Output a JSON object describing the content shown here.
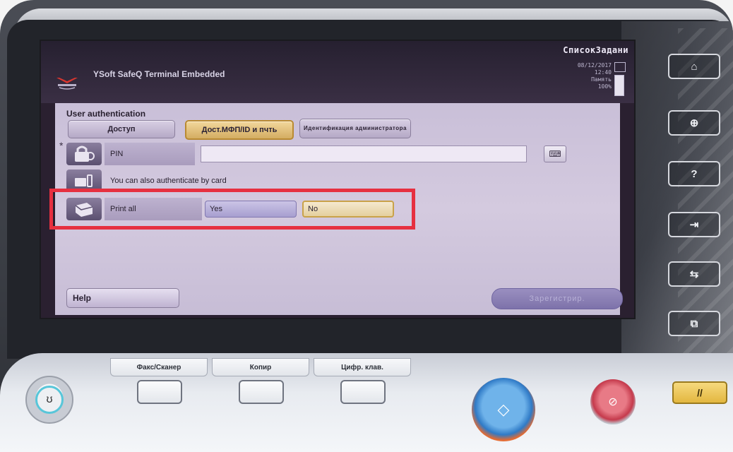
{
  "header": {
    "app_title": "YSoft SafeQ Terminal Embedded",
    "job_list": "СписокЗадани",
    "date": "08/12/2017",
    "time": "12:40",
    "memory_label": "Память",
    "memory_value": "100%"
  },
  "auth": {
    "section_title": "User authentication",
    "tabs": [
      {
        "label": "Доступ",
        "active": false
      },
      {
        "label": "Дост.МФП/ID и пчть",
        "active": true
      },
      {
        "label": "Идентификация администратора",
        "active": false
      }
    ],
    "required_marker": "*",
    "pin_label": "PIN",
    "pin_value": "",
    "card_hint": "You can also authenticate by card",
    "print_all_label": "Print all",
    "print_all_yes": "Yes",
    "print_all_no": "No",
    "print_all_selected": "No"
  },
  "footer": {
    "help_label": "Help",
    "register_label": "Зарегистрир."
  },
  "side_buttons": [
    {
      "icon": "home-icon"
    },
    {
      "icon": "zoom-in-icon"
    },
    {
      "icon": "help-icon"
    },
    {
      "icon": "job-icon"
    },
    {
      "icon": "utility-icon"
    },
    {
      "icon": "preview-icon"
    }
  ],
  "panel": {
    "tab_fax_scan": "Факс/Сканер",
    "tab_copy": "Копир",
    "tab_numpad": "Цифр. клав."
  },
  "colors": {
    "highlight": "#e63040",
    "active_tab": "#d4ad62",
    "start_button": "#2f7ac6",
    "stop_button": "#c53a4c",
    "reset_button": "#e3b73f"
  }
}
